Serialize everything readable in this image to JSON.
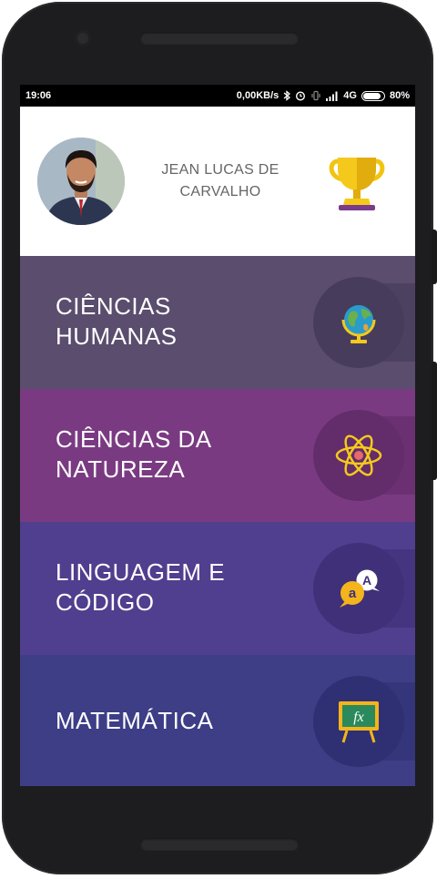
{
  "status_bar": {
    "time": "19:06",
    "speed": "0,00KB/s",
    "network": "4G",
    "battery": "80%",
    "battery_level": 0.8
  },
  "profile": {
    "name": "JEAN LUCAS DE CARVALHO",
    "avatar_icon": "user-photo",
    "trophy_icon": "trophy-icon"
  },
  "categories": [
    {
      "label": "CIÊNCIAS HUMANAS",
      "icon": "globe-icon",
      "color": "#5a4d6e"
    },
    {
      "label": "CIÊNCIAS DA NATUREZA",
      "icon": "atom-icon",
      "color": "#7a3a82"
    },
    {
      "label": "LINGUAGEM E CÓDIGO",
      "icon": "translate-icon",
      "color": "#503e8e"
    },
    {
      "label": "MATEMÁTICA",
      "icon": "function-board-icon",
      "color": "#3d3e86"
    }
  ]
}
